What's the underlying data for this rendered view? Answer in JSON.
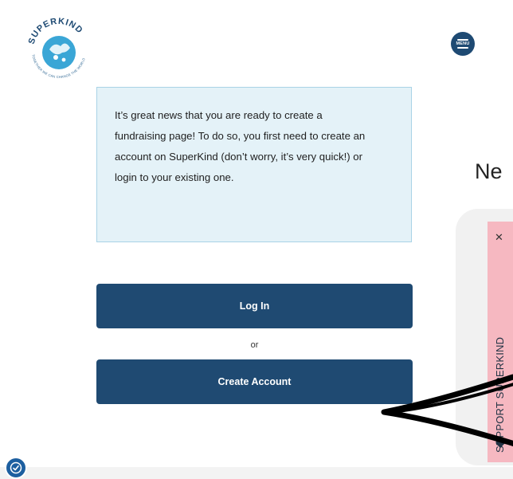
{
  "logo": {
    "brand": "SUPERKIND",
    "tagline": "TOGETHER WE CAN CHANGE THE WORLD",
    "colors": {
      "primary": "#3aa6d6",
      "text": "#1e4a73"
    }
  },
  "header": {
    "menu_label": "MENU"
  },
  "info": {
    "message": "It’s great news that you are ready to create a fundraising page! To do so, you first need to create an account on SuperKind (don’t worry, it’s very quick!) or login to your existing one."
  },
  "actions": {
    "login_label": "Log In",
    "or_label": "or",
    "create_label": "Create Account"
  },
  "side": {
    "heading_partial": "Ne"
  },
  "support_tab": {
    "label": "SUPPORT SUPERKIND",
    "close_symbol": "✕"
  },
  "icons": {
    "menu": "menu-icon",
    "close": "close-icon",
    "heart": "heart-icon",
    "accessibility": "accessibility-icon"
  },
  "colors": {
    "button": "#1f4a72",
    "info_bg": "#e4f2f8",
    "info_border": "#a9d3e6",
    "support_tab": "#f6b8c1"
  }
}
